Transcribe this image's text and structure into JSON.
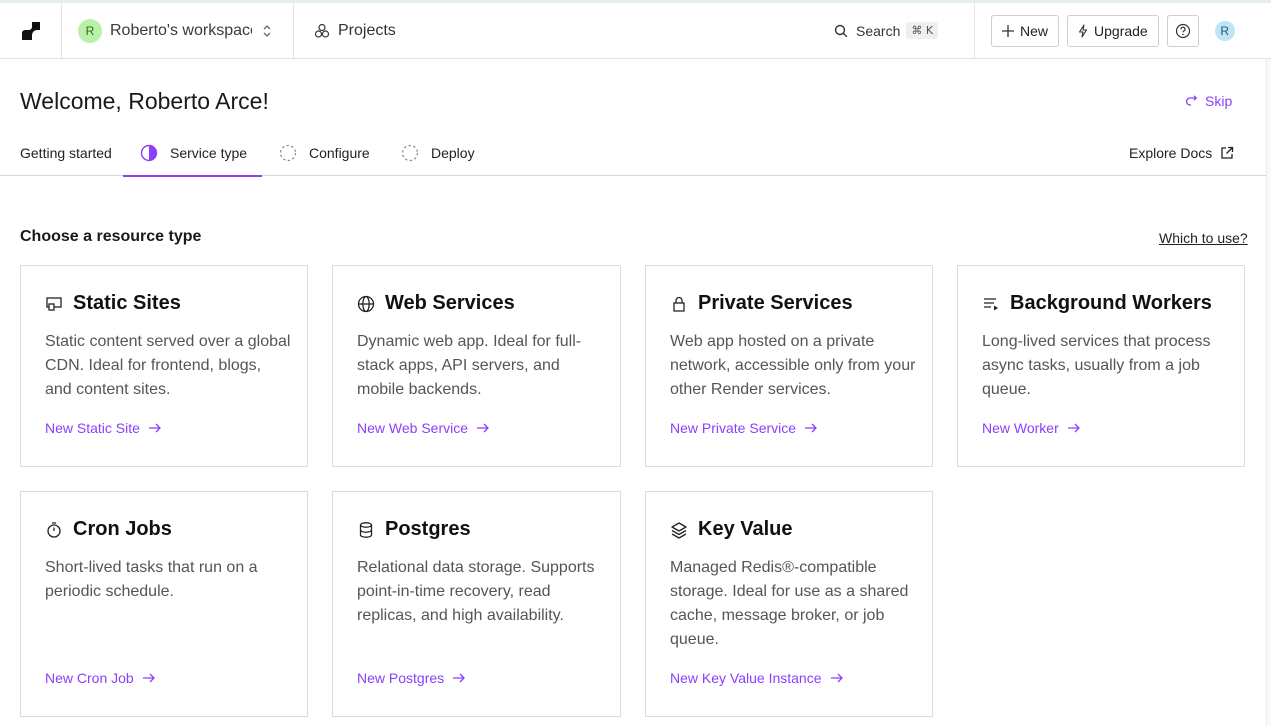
{
  "header": {
    "workspace_avatar": "R",
    "workspace_name": "Roberto's workspace",
    "projects_label": "Projects",
    "search_label": "Search",
    "search_shortcut": "⌘ K",
    "new_label": "New",
    "upgrade_label": "Upgrade",
    "user_avatar": "R"
  },
  "page": {
    "welcome": "Welcome, Roberto Arce!",
    "skip_label": "Skip",
    "explore_docs": "Explore Docs"
  },
  "steps": [
    {
      "label": "Getting started"
    },
    {
      "label": "Service type"
    },
    {
      "label": "Configure"
    },
    {
      "label": "Deploy"
    }
  ],
  "section": {
    "title": "Choose a resource type",
    "which_label": "Which to use?"
  },
  "cards": [
    {
      "icon": "static-site-icon",
      "title": "Static Sites",
      "description": "Static content served over a global CDN. Ideal for frontend, blogs, and content sites.",
      "link": "New Static Site"
    },
    {
      "icon": "globe-icon",
      "title": "Web Services",
      "description": "Dynamic web app. Ideal for full-stack apps, API servers, and mobile backends.",
      "link": "New Web Service"
    },
    {
      "icon": "lock-icon",
      "title": "Private Services",
      "description": "Web app hosted on a private network, accessible only from your other Render services.",
      "link": "New Private Service"
    },
    {
      "icon": "worker-icon",
      "title": "Background Workers",
      "description": "Long-lived services that process async tasks, usually from a job queue.",
      "link": "New Worker"
    },
    {
      "icon": "stopwatch-icon",
      "title": "Cron Jobs",
      "description": "Short-lived tasks that run on a periodic schedule.",
      "link": "New Cron Job"
    },
    {
      "icon": "database-icon",
      "title": "Postgres",
      "description": "Relational data storage. Supports point-in-time recovery, read replicas, and high availability.",
      "link": "New Postgres"
    },
    {
      "icon": "layers-icon",
      "title": "Key Value",
      "description": "Managed Redis®-compatible storage. Ideal for use as a shared cache, message broker, or job queue.",
      "link": "New Key Value Instance"
    }
  ],
  "colors": {
    "accent": "#8a3ffc",
    "border": "#dcdcdc"
  }
}
